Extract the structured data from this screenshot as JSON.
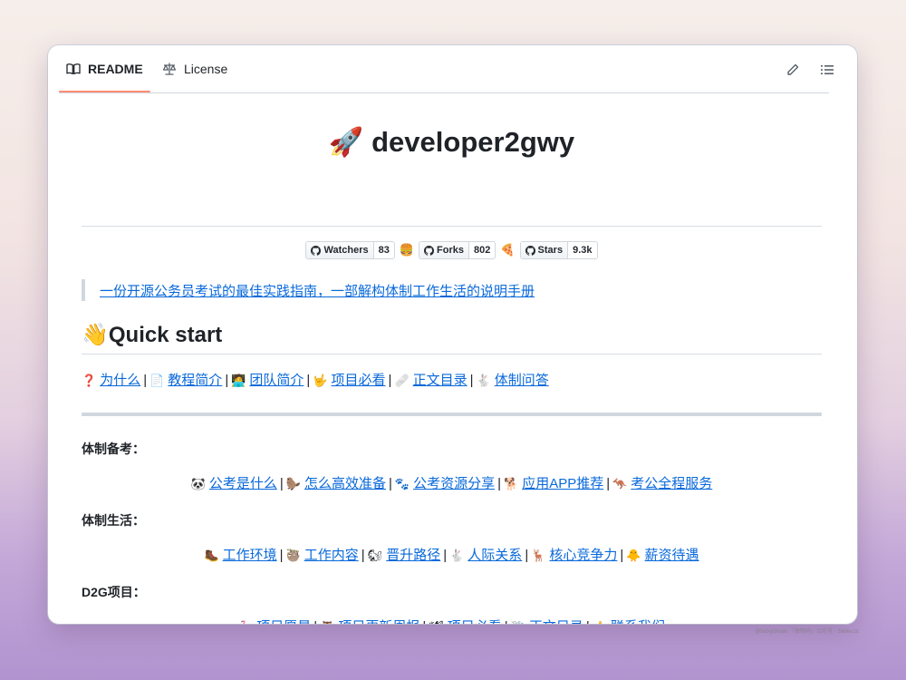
{
  "tabs": {
    "readme": "README",
    "license": "License"
  },
  "title": "developer2gwy",
  "title_emoji": "🚀",
  "badges": [
    {
      "label": "Watchers",
      "count": "83",
      "emoji": "🍔"
    },
    {
      "label": "Forks",
      "count": "802",
      "emoji": "🍕"
    },
    {
      "label": "Stars",
      "count": "9.3k",
      "emoji": ""
    }
  ],
  "tagline": "一份开源公务员考试的最佳实践指南，一部解构体制工作生活的说明手册",
  "quick_start": {
    "emoji": "👋",
    "heading": "Quick start",
    "links": [
      {
        "emoji": "❓",
        "label": "为什么"
      },
      {
        "emoji": "📄",
        "label": "教程简介"
      },
      {
        "emoji": "🧑‍💻",
        "label": "团队简介"
      },
      {
        "emoji": "🤟",
        "label": "项目必看"
      },
      {
        "emoji": "🩹",
        "label": "正文目录"
      },
      {
        "emoji": "🐇",
        "label": "体制问答"
      }
    ]
  },
  "sections": [
    {
      "title": "体制备考：",
      "links": [
        {
          "emoji": "🐼",
          "label": "公考是什么"
        },
        {
          "emoji": "🦫",
          "label": "怎么高效准备"
        },
        {
          "emoji": "🐾",
          "label": "公考资源分享"
        },
        {
          "emoji": "🐕",
          "label": "应用APP推荐"
        },
        {
          "emoji": "🦘",
          "label": "考公全程服务"
        }
      ]
    },
    {
      "title": "体制生活：",
      "links": [
        {
          "emoji": "🥾",
          "label": "工作环境"
        },
        {
          "emoji": "🦥",
          "label": "工作内容"
        },
        {
          "emoji": "🐿",
          "label": "晋升路径"
        },
        {
          "emoji": "🐇",
          "label": "人际关系"
        },
        {
          "emoji": "🦌",
          "label": "核心竞争力"
        },
        {
          "emoji": "🐥",
          "label": "薪资待遇"
        }
      ]
    },
    {
      "title": "D2G项目：",
      "links": [
        {
          "emoji": "🦩",
          "label": "项目愿景"
        },
        {
          "emoji": "🦉",
          "label": "项目更新周报"
        },
        {
          "emoji": "🕊",
          "label": "项目必看"
        },
        {
          "emoji": "🐝",
          "label": "正文目录"
        },
        {
          "emoji": "👍",
          "label": "联系我们"
        }
      ]
    }
  ],
  "separator": "|",
  "credit": "@luckychuan 「体制内」公众号 · Slidev.cc",
  "icons": {
    "readme_tab": "book-icon",
    "license_tab": "scale-icon",
    "edit": "pencil-icon",
    "outline": "list-icon",
    "badge": "github-icon"
  },
  "colors": {
    "link": "#0969da",
    "active_tab_underline": "#fd8c73"
  }
}
